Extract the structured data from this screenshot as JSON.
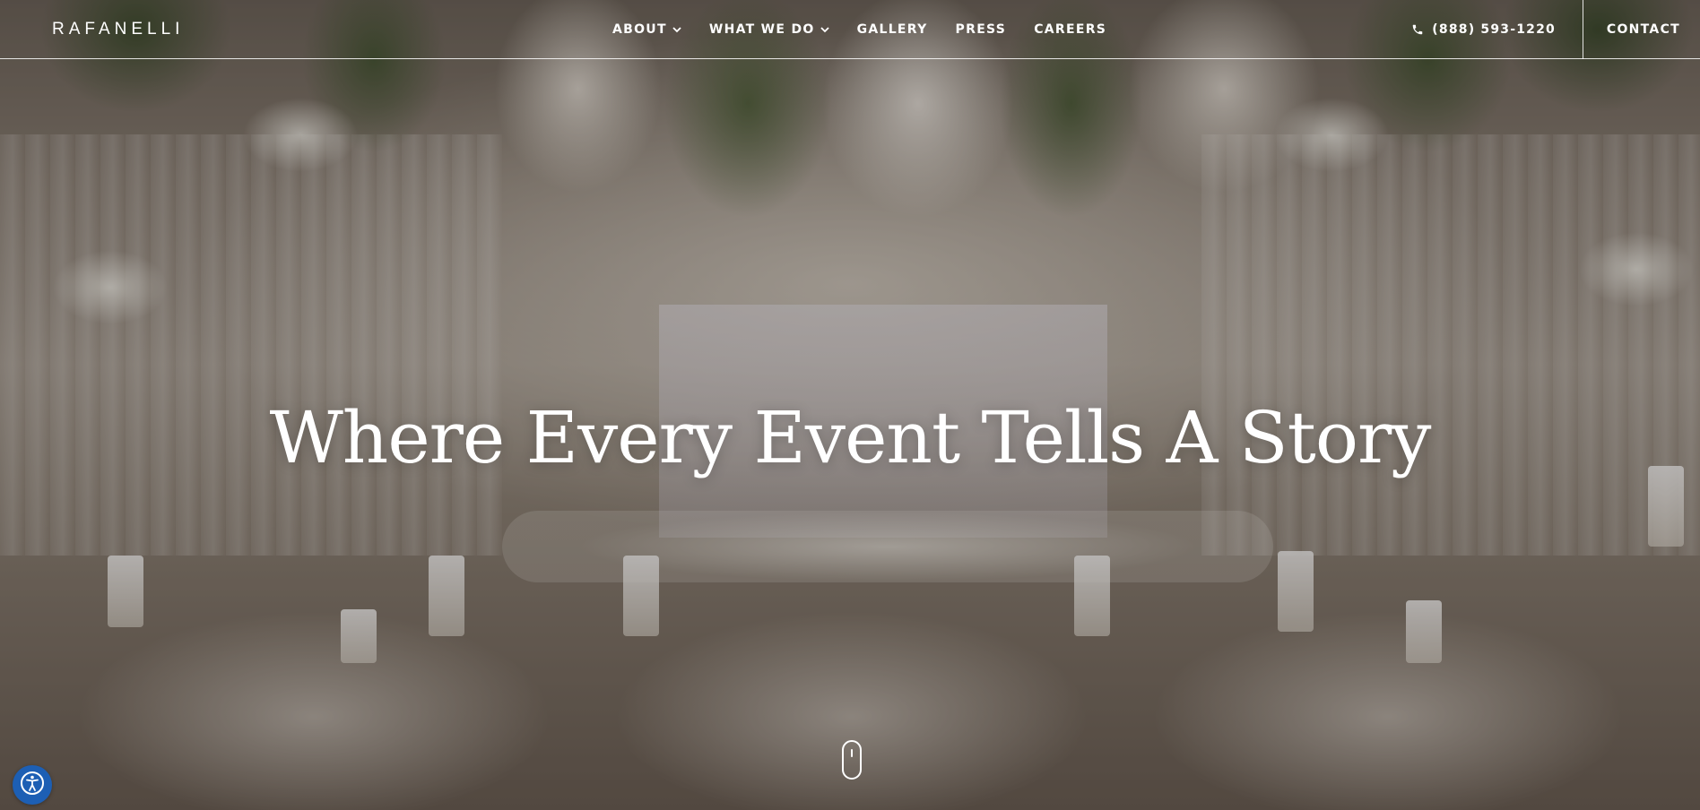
{
  "brand": {
    "logo_text": "RAFANELLI"
  },
  "nav": {
    "items": [
      {
        "label": "ABOUT",
        "has_dropdown": true
      },
      {
        "label": "WHAT WE DO",
        "has_dropdown": true
      },
      {
        "label": "GALLERY",
        "has_dropdown": false
      },
      {
        "label": "PRESS",
        "has_dropdown": false
      },
      {
        "label": "CAREERS",
        "has_dropdown": false
      }
    ],
    "dropdown_icon": "chevron-down-icon"
  },
  "header_right": {
    "phone": "(888) 593-1220",
    "phone_icon": "phone-icon",
    "contact_label": "CONTACT"
  },
  "hero": {
    "headline": "Where Every Event Tells A Story",
    "scroll_icon": "mouse-scroll-icon"
  },
  "accessibility": {
    "icon": "accessibility-icon",
    "color": "#1d5fb4"
  },
  "colors": {
    "text": "#ffffff",
    "header_rule": "#ffffff"
  }
}
